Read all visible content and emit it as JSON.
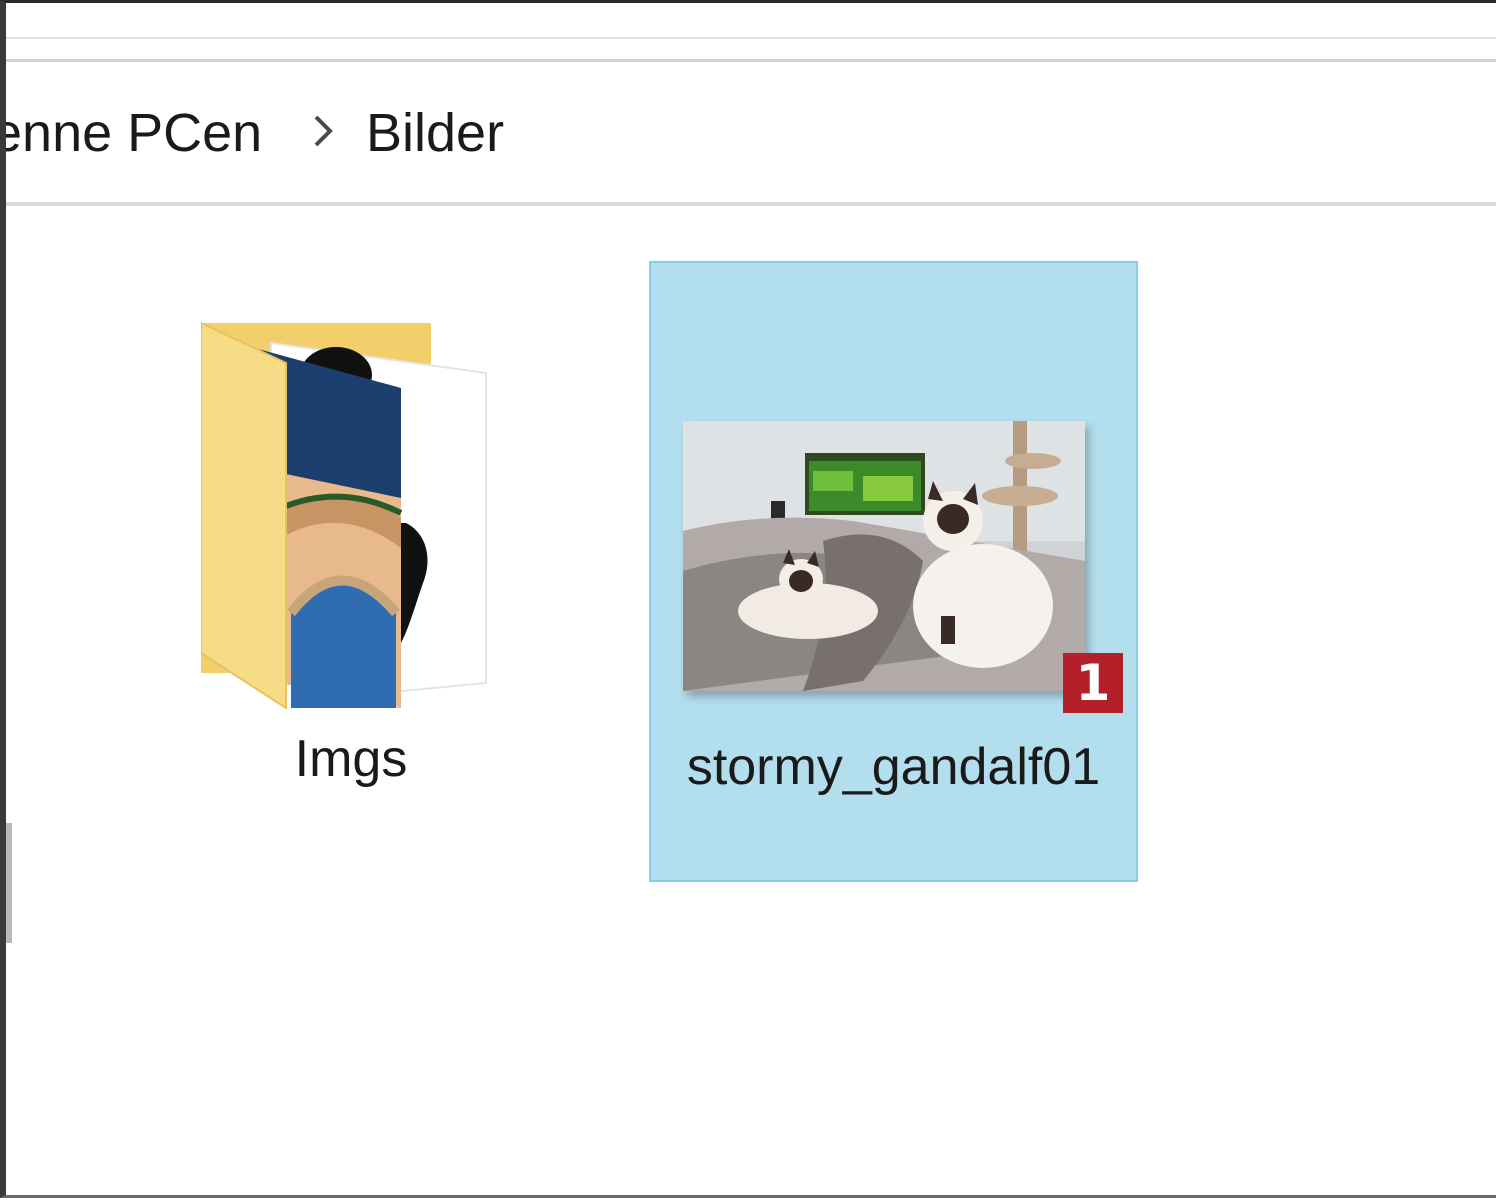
{
  "breadcrumb": {
    "items": [
      "enne PCen",
      "Bilder"
    ],
    "separator_icon": "chevron-right-icon"
  },
  "files": [
    {
      "name": "Imgs",
      "type": "folder",
      "icon": "folder-icon",
      "selected": false
    },
    {
      "name": "stormy_gandalf01",
      "type": "image",
      "icon": "image-thumbnail",
      "selected": true,
      "badge": "1"
    }
  ],
  "colors": {
    "selection_fill": "#b3deed",
    "selection_border": "#8ccbe6",
    "badge": "#b3202a",
    "folder": "#f5d77e"
  }
}
